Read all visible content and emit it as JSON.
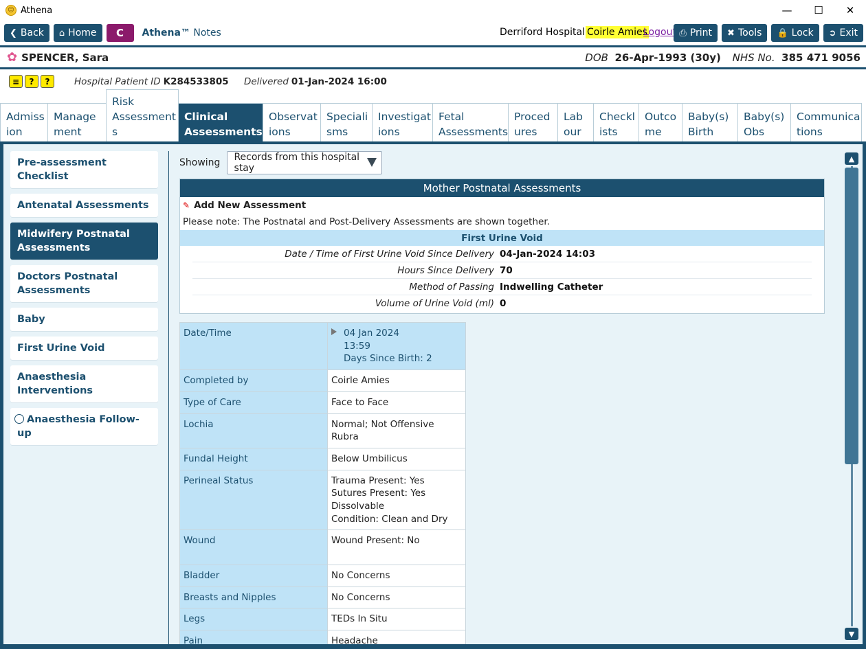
{
  "window": {
    "title": "Athena"
  },
  "toolbar": {
    "back": "Back",
    "home": "Home",
    "c": "C",
    "app_brand": "Athena™",
    "app_module": "Notes",
    "hospital": "Derriford Hospital",
    "user": "Coirle Amies",
    "logout": "Logout",
    "print": "Print",
    "tools": "Tools",
    "lock": "Lock",
    "exit": "Exit"
  },
  "patient": {
    "name": "SPENCER, Sara",
    "dob_label": "DOB",
    "dob": "26-Apr-1993 (30y)",
    "nhs_label": "NHS No.",
    "nhs": "385 471 9056",
    "hpid_label": "Hospital Patient ID",
    "hpid": "K284533805",
    "delivered_label": "Delivered",
    "delivered": "01-Jan-2024 16:00"
  },
  "tabs": [
    {
      "l1": "Admiss",
      "l2": "ion"
    },
    {
      "l1": "Manage",
      "l2": "ment"
    },
    {
      "l1": "Risk",
      "l2": "Assessment",
      "l3": "s"
    },
    {
      "l1": "Clinical",
      "l2": "Assessments"
    },
    {
      "l1": "Observat",
      "l2": "ions"
    },
    {
      "l1": "Speciali",
      "l2": "sms"
    },
    {
      "l1": "Investigat",
      "l2": "ions"
    },
    {
      "l1": "Fetal",
      "l2": "Assessments"
    },
    {
      "l1": "Proced",
      "l2": "ures"
    },
    {
      "l1": "Lab",
      "l2": "our"
    },
    {
      "l1": "Checkl",
      "l2": "ists"
    },
    {
      "l1": "Outco",
      "l2": "me"
    },
    {
      "l1": "Baby(s)",
      "l2": "Birth"
    },
    {
      "l1": "Baby(s)",
      "l2": "Obs"
    },
    {
      "l1": "Communica",
      "l2": "tions"
    }
  ],
  "leftnav": [
    "Pre-assessment Checklist",
    "Antenatal Assessments",
    "Midwifery Postnatal Assessments",
    "Doctors Postnatal Assessments",
    "Baby",
    "First Urine Void",
    "Anaesthesia Interventions",
    "Anaesthesia Follow-up"
  ],
  "filter": {
    "label": "Showing",
    "value": "Records from this hospital stay"
  },
  "mother": {
    "title": "Mother Postnatal Assessments",
    "add_new": "Add New Assessment",
    "note": "Please note:  The Postnatal and Post-Delivery Assessments are shown together.",
    "fuv_title": "First Urine Void",
    "fuv": [
      {
        "label": "Date / Time of First Urine Void Since Delivery",
        "value": "04-Jan-2024 14:03"
      },
      {
        "label": "Hours Since Delivery",
        "value": "70"
      },
      {
        "label": "Method of Passing",
        "value": "Indwelling Catheter"
      },
      {
        "label": "Volume of Urine Void (ml)",
        "value": "0"
      }
    ]
  },
  "assessment": {
    "date_label": "Date/Time",
    "date_l1": "04 Jan 2024",
    "date_l2": "13:59",
    "date_l3": "Days Since Birth: 2",
    "rows": [
      {
        "k": "Completed by",
        "v": [
          "Coirle Amies"
        ]
      },
      {
        "k": "Type of Care",
        "v": [
          "Face to Face"
        ]
      },
      {
        "k": "Lochia",
        "v": [
          "Normal; Not Offensive",
          "Rubra"
        ]
      },
      {
        "k": "Fundal Height",
        "v": [
          "Below Umbilicus"
        ]
      },
      {
        "k": "Perineal Status",
        "v": [
          "Trauma Present: Yes",
          "Sutures Present: Yes",
          "Dissolvable",
          "Condition: Clean and Dry"
        ]
      },
      {
        "k": "Wound",
        "v": [
          "Wound Present: No",
          ""
        ]
      },
      {
        "k": "Bladder",
        "v": [
          "No Concerns"
        ]
      },
      {
        "k": "Breasts and Nipples",
        "v": [
          "No Concerns"
        ]
      },
      {
        "k": "Legs",
        "v": [
          "TEDs In Situ"
        ]
      },
      {
        "k": "Pain",
        "v": [
          "Headache"
        ]
      }
    ]
  },
  "colors": {
    "primary": "#1c506f",
    "light_blue": "#bfe3f7",
    "panel": "#e8f3f8",
    "highlight": "#ffff33",
    "c_button": "#8b1a6b"
  },
  "icons": {
    "back": "chevron-left-icon",
    "home": "home-icon",
    "print": "printer-icon",
    "tools": "tools-icon",
    "lock": "lock-icon",
    "exit": "exit-icon",
    "patient": "flower-icon",
    "add": "pencil-icon"
  }
}
